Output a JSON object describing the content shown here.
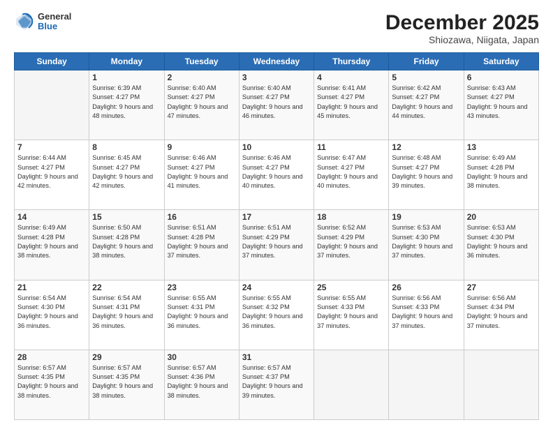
{
  "header": {
    "logo": {
      "general": "General",
      "blue": "Blue"
    },
    "title": "December 2025",
    "subtitle": "Shiozawa, Niigata, Japan"
  },
  "calendar": {
    "days_header": [
      "Sunday",
      "Monday",
      "Tuesday",
      "Wednesday",
      "Thursday",
      "Friday",
      "Saturday"
    ],
    "weeks": [
      [
        {
          "day": "",
          "empty": true
        },
        {
          "day": "1",
          "sunrise": "6:39 AM",
          "sunset": "4:27 PM",
          "daylight": "9 hours and 48 minutes."
        },
        {
          "day": "2",
          "sunrise": "6:40 AM",
          "sunset": "4:27 PM",
          "daylight": "9 hours and 47 minutes."
        },
        {
          "day": "3",
          "sunrise": "6:40 AM",
          "sunset": "4:27 PM",
          "daylight": "9 hours and 46 minutes."
        },
        {
          "day": "4",
          "sunrise": "6:41 AM",
          "sunset": "4:27 PM",
          "daylight": "9 hours and 45 minutes."
        },
        {
          "day": "5",
          "sunrise": "6:42 AM",
          "sunset": "4:27 PM",
          "daylight": "9 hours and 44 minutes."
        },
        {
          "day": "6",
          "sunrise": "6:43 AM",
          "sunset": "4:27 PM",
          "daylight": "9 hours and 43 minutes."
        }
      ],
      [
        {
          "day": "7",
          "sunrise": "6:44 AM",
          "sunset": "4:27 PM",
          "daylight": "9 hours and 42 minutes."
        },
        {
          "day": "8",
          "sunrise": "6:45 AM",
          "sunset": "4:27 PM",
          "daylight": "9 hours and 42 minutes."
        },
        {
          "day": "9",
          "sunrise": "6:46 AM",
          "sunset": "4:27 PM",
          "daylight": "9 hours and 41 minutes."
        },
        {
          "day": "10",
          "sunrise": "6:46 AM",
          "sunset": "4:27 PM",
          "daylight": "9 hours and 40 minutes."
        },
        {
          "day": "11",
          "sunrise": "6:47 AM",
          "sunset": "4:27 PM",
          "daylight": "9 hours and 40 minutes."
        },
        {
          "day": "12",
          "sunrise": "6:48 AM",
          "sunset": "4:27 PM",
          "daylight": "9 hours and 39 minutes."
        },
        {
          "day": "13",
          "sunrise": "6:49 AM",
          "sunset": "4:28 PM",
          "daylight": "9 hours and 38 minutes."
        }
      ],
      [
        {
          "day": "14",
          "sunrise": "6:49 AM",
          "sunset": "4:28 PM",
          "daylight": "9 hours and 38 minutes."
        },
        {
          "day": "15",
          "sunrise": "6:50 AM",
          "sunset": "4:28 PM",
          "daylight": "9 hours and 38 minutes."
        },
        {
          "day": "16",
          "sunrise": "6:51 AM",
          "sunset": "4:28 PM",
          "daylight": "9 hours and 37 minutes."
        },
        {
          "day": "17",
          "sunrise": "6:51 AM",
          "sunset": "4:29 PM",
          "daylight": "9 hours and 37 minutes."
        },
        {
          "day": "18",
          "sunrise": "6:52 AM",
          "sunset": "4:29 PM",
          "daylight": "9 hours and 37 minutes."
        },
        {
          "day": "19",
          "sunrise": "6:53 AM",
          "sunset": "4:30 PM",
          "daylight": "9 hours and 37 minutes."
        },
        {
          "day": "20",
          "sunrise": "6:53 AM",
          "sunset": "4:30 PM",
          "daylight": "9 hours and 36 minutes."
        }
      ],
      [
        {
          "day": "21",
          "sunrise": "6:54 AM",
          "sunset": "4:30 PM",
          "daylight": "9 hours and 36 minutes."
        },
        {
          "day": "22",
          "sunrise": "6:54 AM",
          "sunset": "4:31 PM",
          "daylight": "9 hours and 36 minutes."
        },
        {
          "day": "23",
          "sunrise": "6:55 AM",
          "sunset": "4:31 PM",
          "daylight": "9 hours and 36 minutes."
        },
        {
          "day": "24",
          "sunrise": "6:55 AM",
          "sunset": "4:32 PM",
          "daylight": "9 hours and 36 minutes."
        },
        {
          "day": "25",
          "sunrise": "6:55 AM",
          "sunset": "4:33 PM",
          "daylight": "9 hours and 37 minutes."
        },
        {
          "day": "26",
          "sunrise": "6:56 AM",
          "sunset": "4:33 PM",
          "daylight": "9 hours and 37 minutes."
        },
        {
          "day": "27",
          "sunrise": "6:56 AM",
          "sunset": "4:34 PM",
          "daylight": "9 hours and 37 minutes."
        }
      ],
      [
        {
          "day": "28",
          "sunrise": "6:57 AM",
          "sunset": "4:35 PM",
          "daylight": "9 hours and 38 minutes."
        },
        {
          "day": "29",
          "sunrise": "6:57 AM",
          "sunset": "4:35 PM",
          "daylight": "9 hours and 38 minutes."
        },
        {
          "day": "30",
          "sunrise": "6:57 AM",
          "sunset": "4:36 PM",
          "daylight": "9 hours and 38 minutes."
        },
        {
          "day": "31",
          "sunrise": "6:57 AM",
          "sunset": "4:37 PM",
          "daylight": "9 hours and 39 minutes."
        },
        {
          "day": "",
          "empty": true
        },
        {
          "day": "",
          "empty": true
        },
        {
          "day": "",
          "empty": true
        }
      ]
    ]
  }
}
